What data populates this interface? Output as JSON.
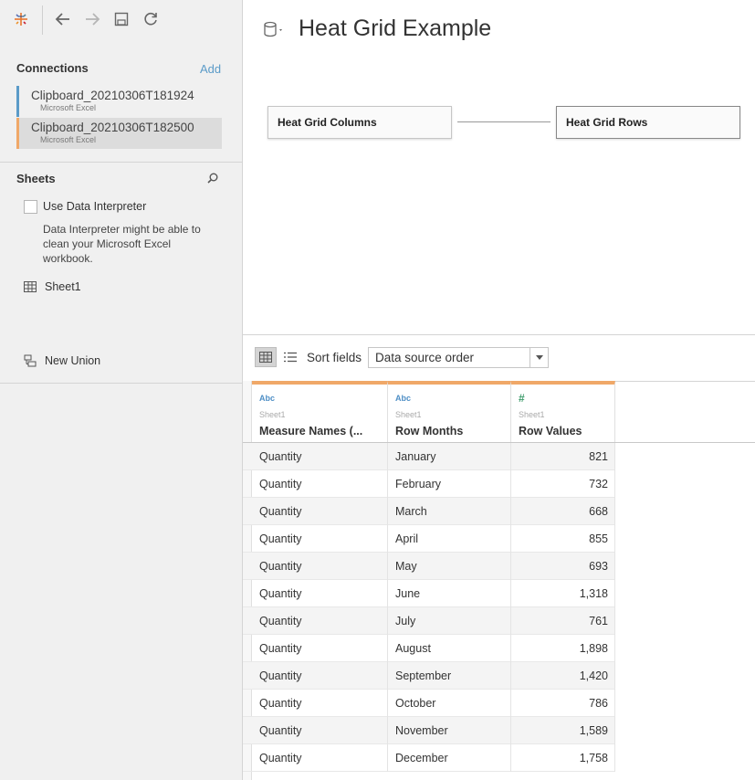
{
  "connections": {
    "title": "Connections",
    "add_label": "Add",
    "items": [
      {
        "name": "Clipboard_20210306T181924",
        "type": "Microsoft Excel"
      },
      {
        "name": "Clipboard_20210306T182500",
        "type": "Microsoft Excel"
      }
    ]
  },
  "sheets": {
    "title": "Sheets",
    "interpreter_label": "Use Data Interpreter",
    "interpreter_desc": "Data Interpreter might be able to clean your Microsoft Excel workbook.",
    "items": [
      "Sheet1"
    ],
    "new_union_label": "New Union"
  },
  "canvas": {
    "title": "Heat Grid Example",
    "tables": [
      "Heat Grid Columns",
      "Heat Grid Rows"
    ]
  },
  "grid_toolbar": {
    "sort_label": "Sort fields",
    "sort_value": "Data source order"
  },
  "colors": {
    "accent_orange": "#f0a868",
    "accent_blue": "#5b9bc8"
  },
  "columns": [
    {
      "type": "Abc",
      "source": "Sheet1",
      "name": "Measure Names (..."
    },
    {
      "type": "Abc",
      "source": "Sheet1",
      "name": "Row Months"
    },
    {
      "type": "#",
      "source": "Sheet1",
      "name": "Row Values"
    }
  ],
  "rows": [
    [
      "Quantity",
      "January",
      "821"
    ],
    [
      "Quantity",
      "February",
      "732"
    ],
    [
      "Quantity",
      "March",
      "668"
    ],
    [
      "Quantity",
      "April",
      "855"
    ],
    [
      "Quantity",
      "May",
      "693"
    ],
    [
      "Quantity",
      "June",
      "1,318"
    ],
    [
      "Quantity",
      "July",
      "761"
    ],
    [
      "Quantity",
      "August",
      "1,898"
    ],
    [
      "Quantity",
      "September",
      "1,420"
    ],
    [
      "Quantity",
      "October",
      "786"
    ],
    [
      "Quantity",
      "November",
      "1,589"
    ],
    [
      "Quantity",
      "December",
      "1,758"
    ]
  ]
}
